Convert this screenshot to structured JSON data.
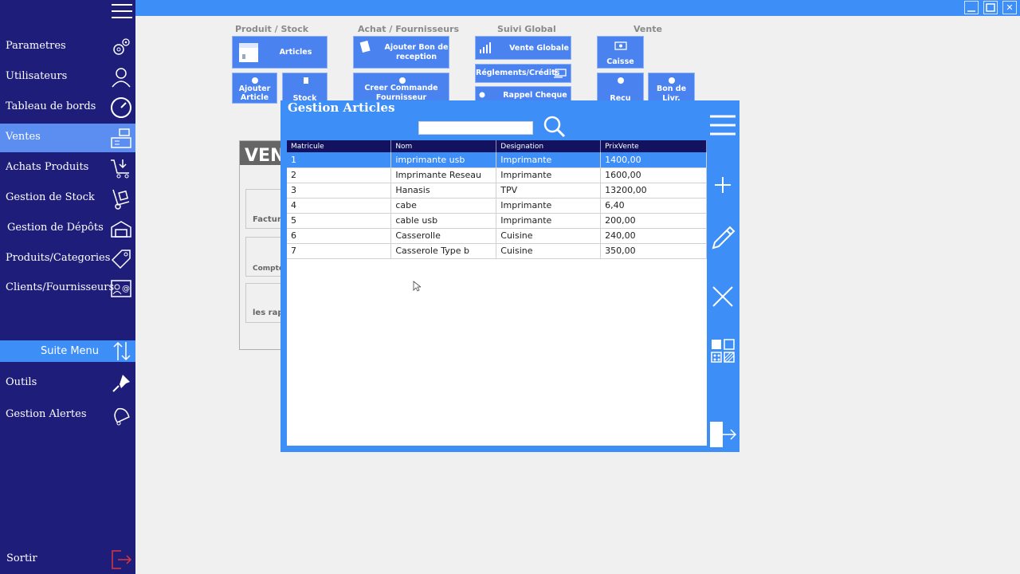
{
  "window": {
    "minimize": "",
    "maximize": "",
    "close": "✕"
  },
  "sidebar": {
    "items": [
      {
        "label": "Parametres",
        "icon": "gears-icon"
      },
      {
        "label": "Utilisateurs",
        "icon": "user-icon"
      },
      {
        "label": "Tableau de bords",
        "icon": "speedometer-icon"
      },
      {
        "label": "Ventes",
        "icon": "cash-register-icon"
      },
      {
        "label": "Achats Produits",
        "icon": "cart-icon"
      },
      {
        "label": "Gestion de Stock",
        "icon": "hand-truck-icon"
      },
      {
        "label": "Gestion de Dépôts",
        "icon": "warehouse-icon"
      },
      {
        "label": "Produits/Categories",
        "icon": "tag-icon"
      },
      {
        "label": "Clients/Fournisseurs",
        "icon": "contact-card-icon"
      }
    ],
    "suite_menu": "Suite Menu",
    "extra": [
      {
        "label": "Outils",
        "icon": "pin-icon"
      },
      {
        "label": "Gestion Alertes",
        "icon": "bell-icon"
      }
    ],
    "sortir": "Sortir"
  },
  "ribbon": {
    "groups": [
      "Produit / Stock",
      "Achat / Fournisseurs",
      "Suivi Global",
      "Vente"
    ],
    "buttons": {
      "articles": "Articles",
      "ajouter_article": "Ajouter Article",
      "stock": "Stock",
      "ajouter_bon": "Ajouter Bon de reception",
      "creer_commande": "Creer Commande Fournisseur",
      "vente_globale": "Vente Globale",
      "reglements": "Réglements/Crédits",
      "rappel_cheque": "Rappel Cheque",
      "caisse": "Caisse",
      "recu": "Recu",
      "bon_livr": "Bon de Livr."
    }
  },
  "background_panel": {
    "heading": "VEN",
    "cards": [
      "Factura",
      "Compte",
      "les rap"
    ]
  },
  "dialog": {
    "title": "Gestion Articles",
    "search": {
      "value": "",
      "placeholder": ""
    },
    "columns": [
      "Matricule",
      "Nom",
      "Designation",
      "PrixVente"
    ],
    "rows": [
      [
        "1",
        "imprimante usb",
        "Imprimante",
        "1400,00"
      ],
      [
        "2",
        "Imprimante Reseau",
        "Imprimante",
        "1600,00"
      ],
      [
        "3",
        "Hanasis",
        "TPV",
        "13200,00"
      ],
      [
        "4",
        "cabe",
        "Imprimante",
        "6,40"
      ],
      [
        "5",
        "cable usb",
        "Imprimante",
        "200,00"
      ],
      [
        "6",
        "Casserolle",
        "Cuisine",
        "240,00"
      ],
      [
        "7",
        "Casserole Type b",
        "Cuisine",
        "350,00"
      ]
    ],
    "selected_row": 0
  },
  "colors": {
    "sidebar": "#1e1e7a",
    "accent": "#3e8ef7",
    "header": "#12125e",
    "exit": "#d9363e"
  }
}
